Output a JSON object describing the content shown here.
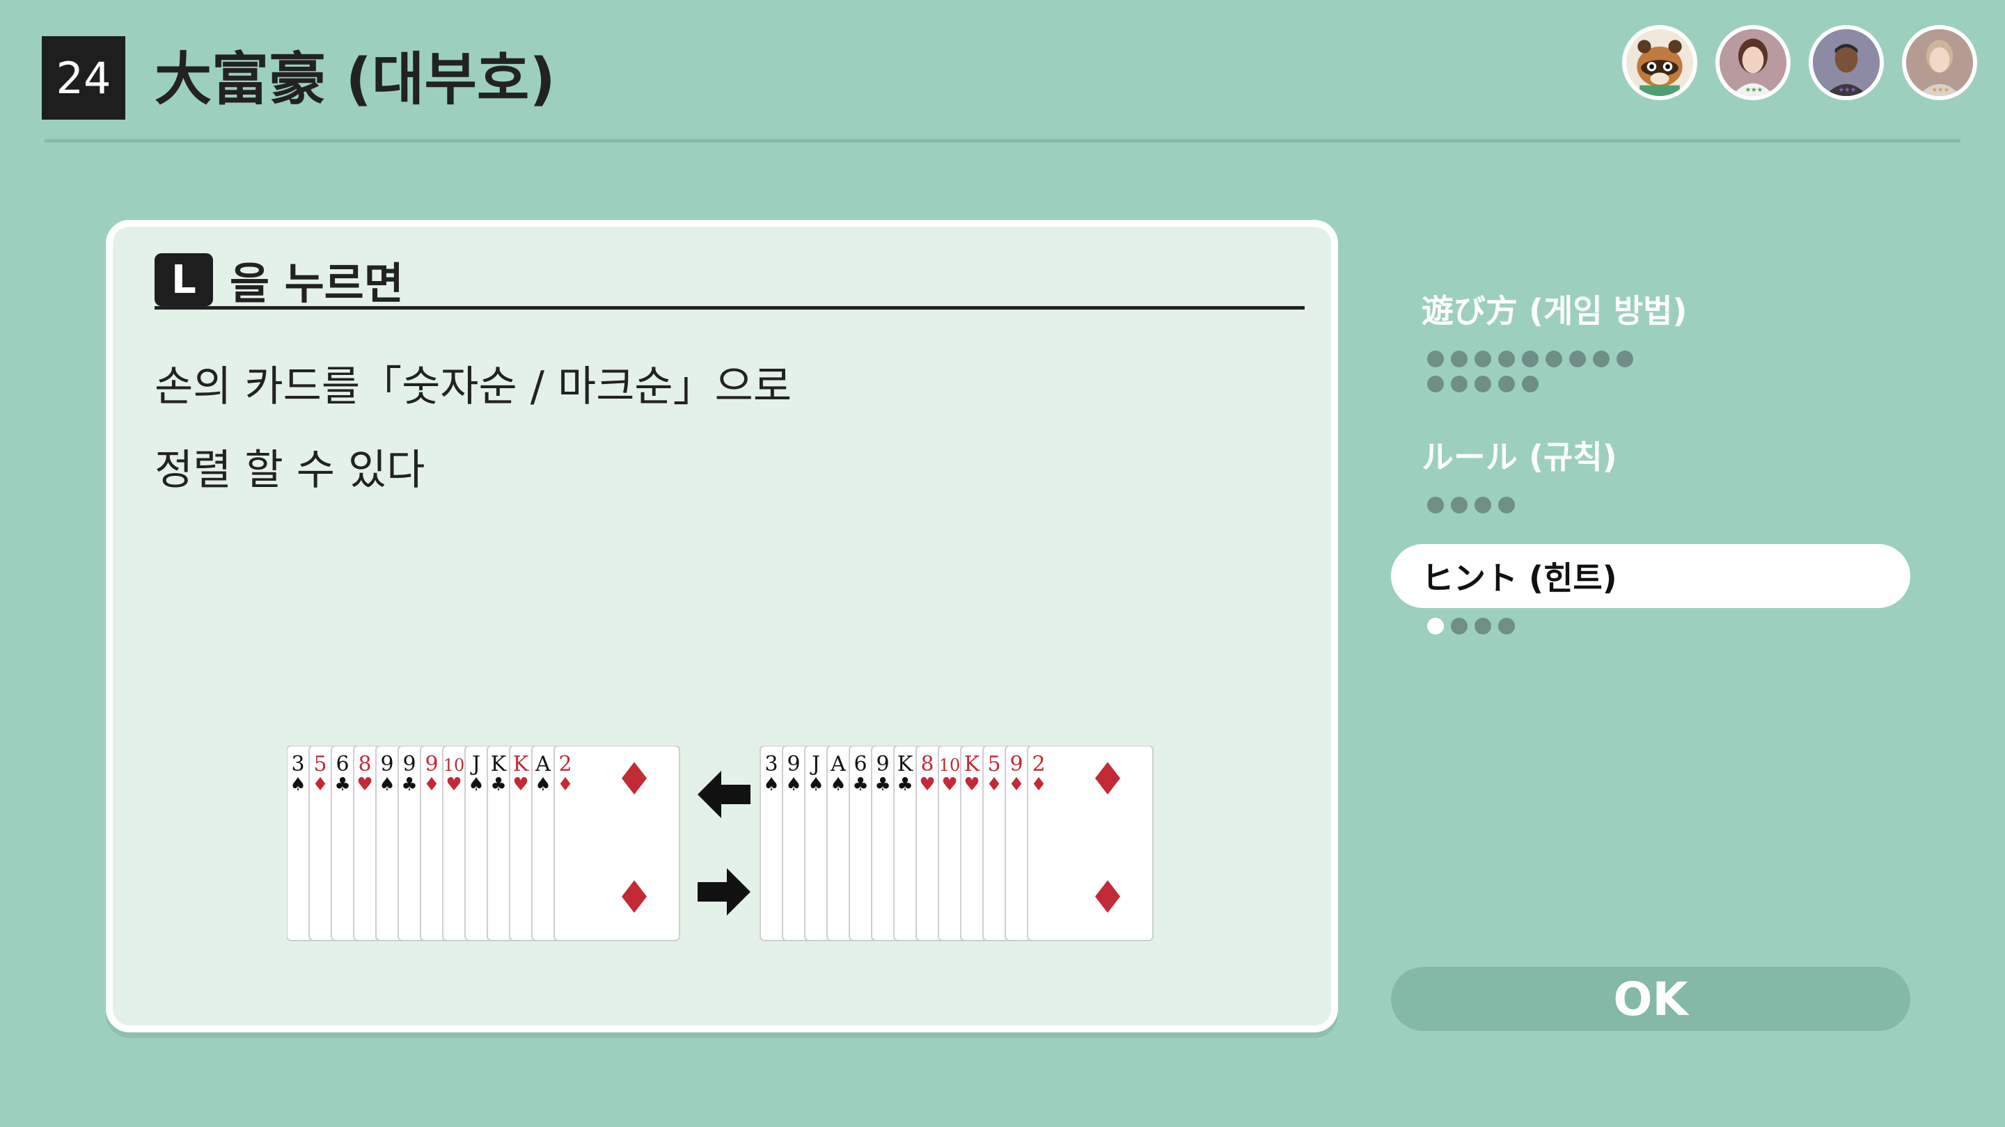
{
  "header": {
    "game_number": "24",
    "title": "大富豪 (대부호)"
  },
  "players": [
    {
      "name": "raccoon-avatar"
    },
    {
      "name": "player-avatar-1"
    },
    {
      "name": "player-avatar-2"
    },
    {
      "name": "player-avatar-3"
    }
  ],
  "panel": {
    "key_label": "L",
    "heading": "을 누르면",
    "description_lines": [
      "손의 카드를「숫자순 / 마크순」으로",
      "정렬 할 수 있다"
    ]
  },
  "cards": {
    "left_hand": [
      "3♠",
      "5♦",
      "6♣",
      "8♥",
      "9♠",
      "9♣",
      "9♦",
      "10♥",
      "J♠",
      "K♣",
      "K♥",
      "A♠",
      "2♦"
    ],
    "right_hand": [
      "3♠",
      "9♠",
      "J♠",
      "A♠",
      "6♣",
      "9♣",
      "K♣",
      "8♥",
      "10♥",
      "K♥",
      "5♦",
      "9♦",
      "2♦"
    ]
  },
  "menu": {
    "items": [
      {
        "label": "遊び方 (게임 방법)",
        "pages": 14,
        "current": 0
      },
      {
        "label": "ルール (규칙)",
        "pages": 4,
        "current": 0
      },
      {
        "label": "ヒント (힌트)",
        "pages": 4,
        "current": 1
      }
    ],
    "active_index": 2
  },
  "ok_label": "OK",
  "colors": {
    "background": "#9dcfbf",
    "panel": "#e4f1e8",
    "ok_button": "#84b8a7",
    "card_red": "#c22a35"
  }
}
